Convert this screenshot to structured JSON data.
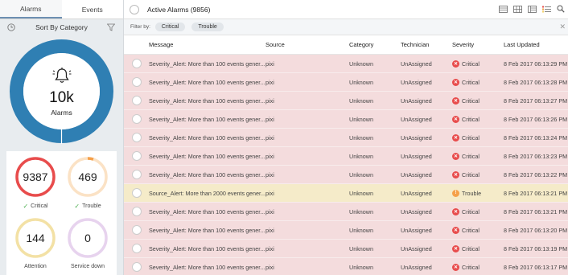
{
  "tabs": [
    {
      "label": "Alarms",
      "active": true
    },
    {
      "label": "Events",
      "active": false
    }
  ],
  "sidebar": {
    "sort_label": "Sort By Category",
    "icons": {
      "clock": "clock-icon",
      "filter": "filter-icon",
      "bell": "bell-icon"
    },
    "total": {
      "count": "10k",
      "label": "Alarms"
    },
    "cards": [
      {
        "count": "9387",
        "label": "Critical",
        "color": "#e84c4c",
        "checked": true,
        "fill": 1.0
      },
      {
        "count": "469",
        "label": "Trouble",
        "color": "#f5a04a",
        "checked": true,
        "fill": 0.05
      },
      {
        "count": "144",
        "label": "Attention",
        "color": "#f3e1a5",
        "checked": false,
        "fill": 0.0
      },
      {
        "count": "0",
        "label": "Service down",
        "color": "#e7d3ee",
        "checked": false,
        "fill": 0.0
      }
    ]
  },
  "header": {
    "title": "Active Alarms (9856)",
    "toolbar_icons": [
      "list-view-icon",
      "grid-view-icon",
      "column-view-icon",
      "legend-icon",
      "search-icon"
    ]
  },
  "filter": {
    "label": "Filter by:",
    "chips": [
      "Critical",
      "Trouble"
    ]
  },
  "table": {
    "columns": [
      "Message",
      "Source",
      "Category",
      "Technician",
      "Severity",
      "Last Updated"
    ],
    "rows": [
      {
        "message": "Severity_Alert: More than 100 events gener...",
        "source": "pixi",
        "category": "Unknown",
        "technician": "UnAssigned",
        "severity": "Critical",
        "updated": "8 Feb 2017 06:13:29 PM S"
      },
      {
        "message": "Severity_Alert: More than 100 events gener...",
        "source": "pixi",
        "category": "Unknown",
        "technician": "UnAssigned",
        "severity": "Critical",
        "updated": "8 Feb 2017 06:13:28 PM S"
      },
      {
        "message": "Severity_Alert: More than 100 events gener...",
        "source": "pixi",
        "category": "Unknown",
        "technician": "UnAssigned",
        "severity": "Critical",
        "updated": "8 Feb 2017 06:13:27 PM S"
      },
      {
        "message": "Severity_Alert: More than 100 events gener...",
        "source": "pixi",
        "category": "Unknown",
        "technician": "UnAssigned",
        "severity": "Critical",
        "updated": "8 Feb 2017 06:13:26 PM S"
      },
      {
        "message": "Severity_Alert: More than 100 events gener...",
        "source": "pixi",
        "category": "Unknown",
        "technician": "UnAssigned",
        "severity": "Critical",
        "updated": "8 Feb 2017 06:13:24 PM S"
      },
      {
        "message": "Severity_Alert: More than 100 events gener...",
        "source": "pixi",
        "category": "Unknown",
        "technician": "UnAssigned",
        "severity": "Critical",
        "updated": "8 Feb 2017 06:13:23 PM S"
      },
      {
        "message": "Severity_Alert: More than 100 events gener...",
        "source": "pixi",
        "category": "Unknown",
        "technician": "UnAssigned",
        "severity": "Critical",
        "updated": "8 Feb 2017 06:13:22 PM S"
      },
      {
        "message": "Source_Alert: More than 2000 events gener...",
        "source": "pixi",
        "category": "Unknown",
        "technician": "UnAssigned",
        "severity": "Trouble",
        "updated": "8 Feb 2017 06:13:21 PM S"
      },
      {
        "message": "Severity_Alert: More than 100 events gener...",
        "source": "pixi",
        "category": "Unknown",
        "technician": "UnAssigned",
        "severity": "Critical",
        "updated": "8 Feb 2017 06:13:21 PM S"
      },
      {
        "message": "Severity_Alert: More than 100 events gener...",
        "source": "pixi",
        "category": "Unknown",
        "technician": "UnAssigned",
        "severity": "Critical",
        "updated": "8 Feb 2017 06:13:20 PM S"
      },
      {
        "message": "Severity_Alert: More than 100 events gener...",
        "source": "pixi",
        "category": "Unknown",
        "technician": "UnAssigned",
        "severity": "Critical",
        "updated": "8 Feb 2017 06:13:19 PM S"
      },
      {
        "message": "Severity_Alert: More than 100 events gener...",
        "source": "pixi",
        "category": "Unknown",
        "technician": "UnAssigned",
        "severity": "Critical",
        "updated": "8 Feb 2017 06:13:17 PM S"
      }
    ]
  },
  "colors": {
    "critical": "#e84c4c",
    "trouble": "#f5a04a",
    "donut": "#2f7fb3",
    "critical_row": "#f4dcdd",
    "trouble_row": "#f5ebc9"
  }
}
